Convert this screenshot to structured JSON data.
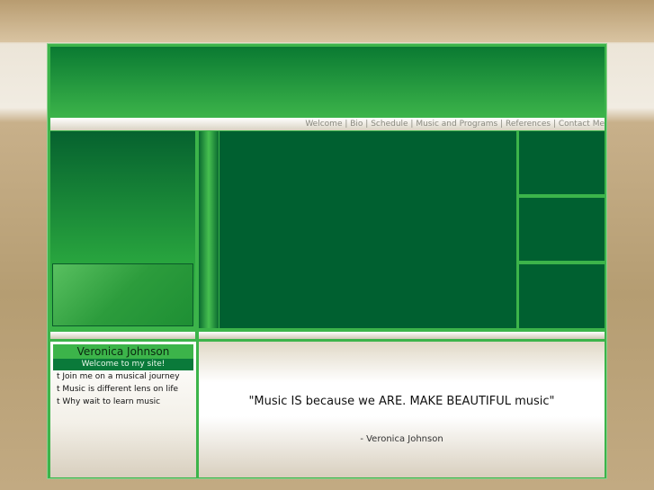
{
  "nav": [
    "Welcome",
    "Bio",
    "Schedule",
    "Music and Programs",
    "References",
    "Contact Me"
  ],
  "sidebar": {
    "name": "Veronica Johnson",
    "welcome": "Welcome to my site!",
    "items": [
      "t Join me on a musical journey",
      "t Music is different lens on life",
      "t Why wait to learn music"
    ]
  },
  "quote": {
    "text": "\"Music IS because we ARE. MAKE BEAUTIFUL music\"",
    "author": "- Veronica Johnson"
  }
}
